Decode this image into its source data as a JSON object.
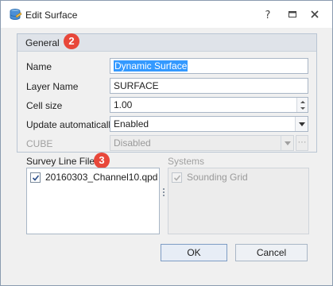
{
  "window": {
    "title": "Edit Surface"
  },
  "general": {
    "title": "General",
    "badge": "2",
    "name": {
      "label": "Name",
      "value": "Dynamic Surface"
    },
    "layer_name": {
      "label": "Layer Name",
      "value": "SURFACE"
    },
    "cell_size": {
      "label": "Cell size",
      "value": "1.00"
    },
    "update_automatically": {
      "label": "Update automatically",
      "value": "Enabled"
    },
    "cube": {
      "label": "CUBE",
      "value": "Disabled"
    }
  },
  "survey_line_files": {
    "title": "Survey Line Files",
    "badge": "3",
    "items": [
      {
        "label": "20160303_Channel10.qpd",
        "checked": true
      }
    ]
  },
  "systems": {
    "title": "Systems",
    "items": [
      {
        "label": "Sounding Grid",
        "checked": true
      }
    ]
  },
  "buttons": {
    "ok": "OK",
    "cancel": "Cancel"
  },
  "colors": {
    "badge": "#e8473a",
    "selection": "#3399ff",
    "group_header": "#dfe3e9"
  }
}
